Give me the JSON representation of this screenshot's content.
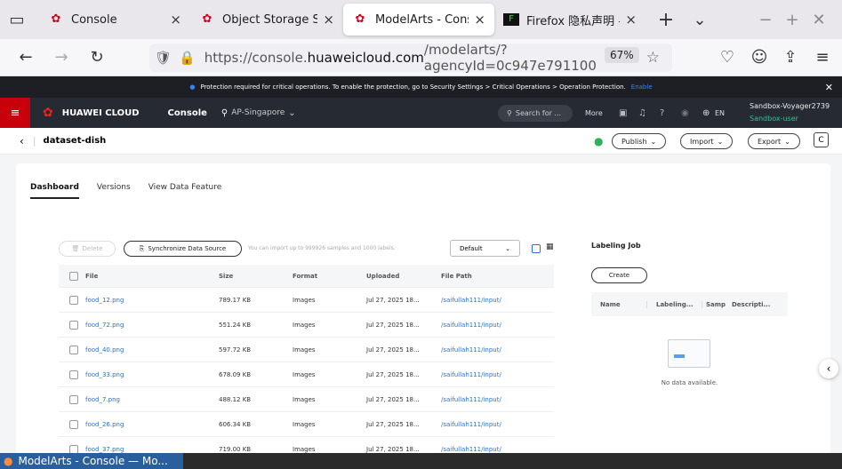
{
  "browser": {
    "tabs": [
      {
        "title": "Console",
        "close": "×"
      },
      {
        "title": "Object Storage Servic",
        "close": "×"
      },
      {
        "title": "ModelArts - Console",
        "close": "×"
      },
      {
        "title": "Firefox 隐私声明 — F",
        "close": "×"
      }
    ],
    "new_tab": "+",
    "url_pre": "https://console.",
    "url_domain": "huaweicloud.com",
    "url_post": "/modelarts/?agencyId=0c947e791100",
    "zoom": "67%"
  },
  "banner": {
    "text": "Protection required for critical operations. To enable the protection, go to Security Settings > Critical Operations > Operation Protection.",
    "link": "Enable"
  },
  "header": {
    "brand": "HUAWEI CLOUD",
    "console": "Console",
    "region": "AP-Singapore",
    "search": "Search for ...",
    "more": "More",
    "lang": "EN",
    "user": "Sandbox-Voyager2739",
    "role": "Sandbox-user"
  },
  "page": {
    "title": "dataset-dish",
    "publish": "Publish",
    "import": "Import",
    "export": "Export"
  },
  "tabs": [
    "Dashboard",
    "Versions",
    "View Data Feature"
  ],
  "toolbar": {
    "delete": "Delete",
    "sync": "Synchronize Data Source",
    "note": "You can import up to 999926 samples and 1000 labels.",
    "sort": "Default"
  },
  "table": {
    "headers": [
      "File",
      "Size",
      "Format",
      "Uploaded",
      "File Path"
    ],
    "rows": [
      [
        "food_12.png",
        "789.17 KB",
        "Images",
        "Jul 27, 2025 18...",
        "/saifullah111/input/"
      ],
      [
        "food_72.png",
        "551.24 KB",
        "Images",
        "Jul 27, 2025 18...",
        "/saifullah111/input/"
      ],
      [
        "food_40.png",
        "597.72 KB",
        "Images",
        "Jul 27, 2025 18...",
        "/saifullah111/input/"
      ],
      [
        "food_33.png",
        "678.09 KB",
        "Images",
        "Jul 27, 2025 18...",
        "/saifullah111/input/"
      ],
      [
        "food_7.png",
        "488.12 KB",
        "Images",
        "Jul 27, 2025 18...",
        "/saifullah111/input/"
      ],
      [
        "food_26.png",
        "606.34 KB",
        "Images",
        "Jul 27, 2025 18...",
        "/saifullah111/input/"
      ],
      [
        "food_37.png",
        "719.00 KB",
        "Images",
        "Jul 27, 2025 18...",
        "/saifullah111/input/"
      ]
    ]
  },
  "labeling": {
    "title": "Labeling Job",
    "create": "Create",
    "cols": [
      "Name",
      "Labeling...",
      "Samp",
      "Descripti..."
    ],
    "empty": "No data available."
  },
  "taskbar": {
    "window": "ModelArts - Console — Mo..."
  }
}
